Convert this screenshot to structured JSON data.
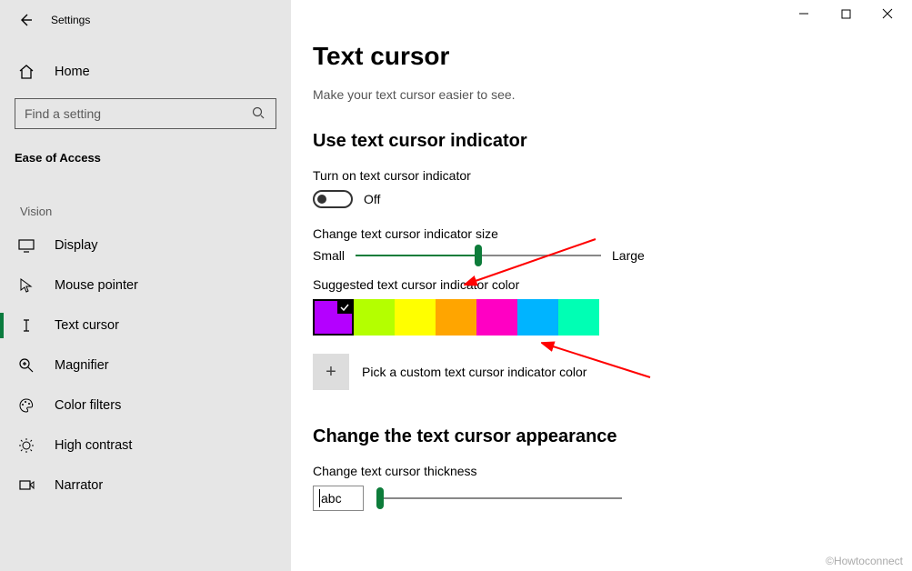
{
  "header": {
    "title": "Settings",
    "home_label": "Home",
    "search_placeholder": "Find a setting",
    "category": "Ease of Access",
    "group": "Vision"
  },
  "sidebar": {
    "items": [
      {
        "label": "Display"
      },
      {
        "label": "Mouse pointer"
      },
      {
        "label": "Text cursor"
      },
      {
        "label": "Magnifier"
      },
      {
        "label": "Color filters"
      },
      {
        "label": "High contrast"
      },
      {
        "label": "Narrator"
      }
    ]
  },
  "page": {
    "title": "Text cursor",
    "subtitle": "Make your text cursor easier to see.",
    "section1": "Use text cursor indicator",
    "toggle_label": "Turn on text cursor indicator",
    "toggle_state": "Off",
    "size_label": "Change text cursor indicator size",
    "size_small": "Small",
    "size_large": "Large",
    "color_label": "Suggested text cursor indicator color",
    "custom_label": "Pick a custom text cursor indicator color",
    "section2": "Change the text cursor appearance",
    "thickness_label": "Change text cursor thickness",
    "preview_text": "abc"
  },
  "colors": [
    "#b400ff",
    "#b4ff00",
    "#ffff00",
    "#ffa500",
    "#ff00c3",
    "#00b4ff",
    "#00ffb4"
  ],
  "watermark": "©Howtoconnect"
}
